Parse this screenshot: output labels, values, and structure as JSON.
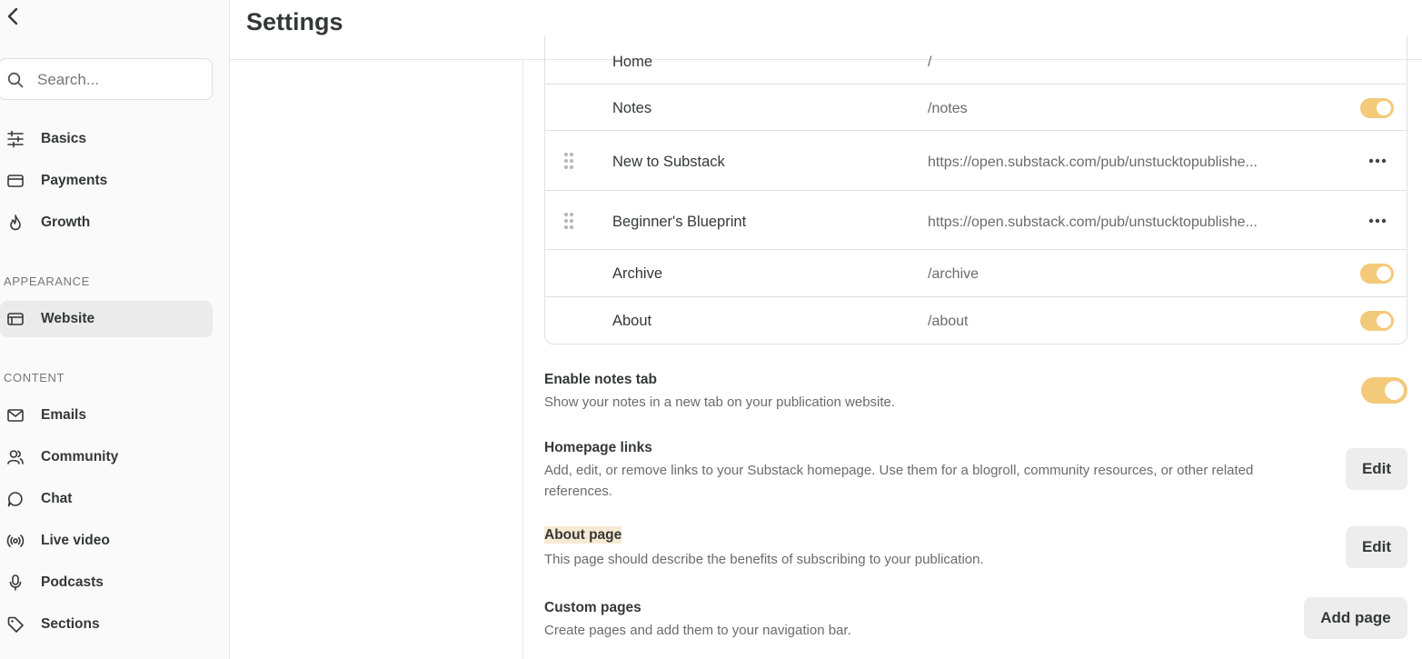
{
  "header": {
    "title": "Settings"
  },
  "sidebar": {
    "search": {
      "placeholder": "Search..."
    },
    "items": [
      {
        "label": "Basics",
        "icon": "sliders-icon"
      },
      {
        "label": "Payments",
        "icon": "credit-card-icon"
      },
      {
        "label": "Growth",
        "icon": "flame-icon"
      }
    ],
    "sections": [
      {
        "label": "APPEARANCE",
        "items": [
          {
            "label": "Website",
            "icon": "browser-window-icon",
            "active": true
          }
        ]
      },
      {
        "label": "CONTENT",
        "items": [
          {
            "label": "Emails",
            "icon": "mail-icon"
          },
          {
            "label": "Community",
            "icon": "users-icon"
          },
          {
            "label": "Chat",
            "icon": "chat-bubble-icon"
          },
          {
            "label": "Live video",
            "icon": "broadcast-icon"
          },
          {
            "label": "Podcasts",
            "icon": "microphone-icon"
          },
          {
            "label": "Sections",
            "icon": "tag-icon"
          }
        ]
      }
    ]
  },
  "nav_rows": [
    {
      "name": "Home",
      "path": "/"
    },
    {
      "name": "Notes",
      "path": "/notes",
      "enabled": true
    },
    {
      "name": "New to Substack",
      "path": "https://open.substack.com/pub/unstucktopublishe..."
    },
    {
      "name": "Beginner's Blueprint",
      "path": "https://open.substack.com/pub/unstucktopublishe..."
    },
    {
      "name": "Archive",
      "path": "/archive",
      "enabled": true
    },
    {
      "name": "About",
      "path": "/about",
      "enabled": true
    }
  ],
  "settings": {
    "notes_tab": {
      "title": "Enable notes tab",
      "desc": "Show your notes in a new tab on your publication website.",
      "enabled": true
    },
    "homepage_links": {
      "title": "Homepage links",
      "desc": "Add, edit, or remove links to your Substack homepage. Use them for a blogroll, community resources, or other related references.",
      "button": "Edit"
    },
    "about_page": {
      "title": "About page",
      "desc": "This page should describe the benefits of subscribing to your publication.",
      "button": "Edit"
    },
    "custom_pages": {
      "title": "Custom pages",
      "desc": "Create pages and add them to your navigation bar.",
      "button": "Add page"
    }
  },
  "colors": {
    "toggle_on": "#f3c97a",
    "active_nav_bg": "#ebebeb",
    "button_bg": "#ededed",
    "highlight": "#f7ead3"
  }
}
